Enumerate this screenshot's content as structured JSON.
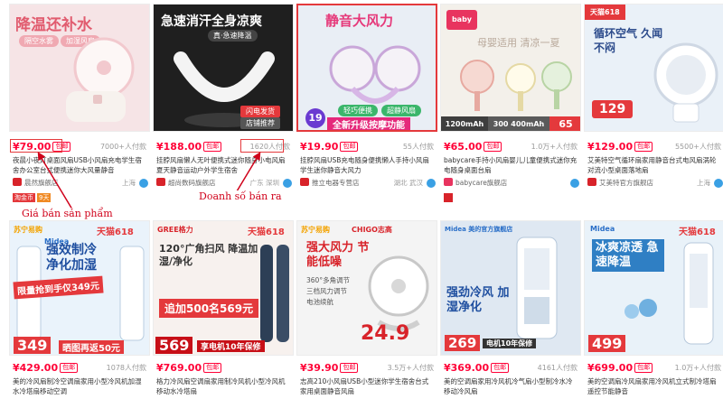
{
  "products": [
    {
      "price": "¥79.00",
      "tag": "包邮",
      "sales": "7000+人付款",
      "title": "夜晨小夜灯桌面风扇USB小风扇充电学生宿舍办公室台式便携迷你大风量静音",
      "shop": "晨然旗舰店",
      "location": "上海",
      "image_heading": "降温还补水",
      "image_sub": [
        "隔空水雾",
        "加湿风扇"
      ],
      "badges": [
        "淘金币",
        "9天"
      ]
    },
    {
      "price": "¥188.00",
      "tag": "包邮",
      "sales": "1620人付款",
      "title": "挂脖风扇懒人无叶便携式迷你随身小电风扇夏天静音运动户外学生宿舍",
      "shop": "超尚数码旗舰店",
      "location": "广东 深圳",
      "image_heading": "急速消汗全身凉爽",
      "image_sub": [
        "真·急速降温"
      ],
      "image_badges": [
        "闪电发货",
        "店铺推荐"
      ]
    },
    {
      "price": "¥19.90",
      "tag": "包邮",
      "sales": "55人付款",
      "title": "挂脖风扇USB充电随身便携懒人手持小风扇学生迷你静音大风力",
      "shop": "推立电器专营店",
      "location": "湖北 武汉",
      "image_heading": "静音大风力",
      "image_price": "19",
      "image_banner": "全新升级按摩功能",
      "image_badges": [
        "轻巧便携",
        "超静风扇"
      ]
    },
    {
      "price": "¥65.00",
      "tag": "包邮",
      "sales": "1.0万+人付款",
      "title": "babycare手持小风扇婴儿儿童便携式迷你充电随身桌面台扇",
      "shop": "babycare旗舰店",
      "location": "",
      "image_heading": "母婴适用 清凉一夏",
      "image_strip": [
        "1200mAh",
        "300 400mAh",
        "65"
      ]
    },
    {
      "price": "¥129.00",
      "tag": "包邮",
      "sales": "5500+人付款",
      "title": "艾美特空气循环扇家用静音台式电风扇涡轮对流小型桌面落地扇",
      "shop": "艾美特官方旗舰店",
      "location": "上海",
      "image_heading": "循环空气 久闻不闷",
      "image_price": "129",
      "image_logo": "天猫618"
    },
    {
      "price": "¥429.00",
      "tag": "包邮",
      "sales": "1078人付款",
      "title": "美的冷风扇制冷空调扇家用小型冷风机加湿水冷塔扇移动空调",
      "shop": "苏宁易购官方旗舰店",
      "location": "",
      "image_heading": "强效制冷 净化加湿",
      "image_promo": "限量抢到手仅349元",
      "image_price": "349",
      "image_banner": "晒图再返50元",
      "image_logos": [
        "苏宁易购",
        "天猫618",
        "Midea"
      ]
    },
    {
      "price": "¥769.00",
      "tag": "包邮",
      "sales": "",
      "title": "格力冷风扇空调扇家用制冷风机小型冷风机移动水冷塔扇",
      "shop": "格力官方旗舰店",
      "location": "",
      "image_heading": "120°广角扫风 降温加湿/净化",
      "image_promo": "追加500名569元",
      "image_price": "569",
      "image_banner": "享电机10年保修",
      "image_logos": [
        "GREE格力",
        "天猫618"
      ]
    },
    {
      "price": "¥39.90",
      "tag": "包邮",
      "sales": "3.5万+人付款",
      "title": "志高210小风扇USB小型迷你学生宿舍台式家用桌面静音风扇",
      "shop": "志高苏宁自营旗舰店",
      "location": "",
      "image_heading": "强大风力 节能低噪",
      "image_features": [
        "360°多角调节",
        "三档风力调节",
        "电池续航"
      ],
      "image_price": "24.9",
      "image_logos": [
        "苏宁易购",
        "CHIGO志高"
      ]
    },
    {
      "price": "¥369.00",
      "tag": "包邮",
      "sales": "4161人付款",
      "title": "美的空调扇家用冷风机冷气扇小型制冷水冷移动冷风扇",
      "shop": "美的官方旗舰店",
      "location": "",
      "image_heading": "强劲冷风 加湿净化",
      "image_price": "269",
      "image_banner": "电机10年保修",
      "image_logos": [
        "Midea 美的官方旗舰店"
      ]
    },
    {
      "price": "¥699.00",
      "tag": "包邮",
      "sales": "1.0万+人付款",
      "title": "美的空调扇冷风扇家用冷风机立式制冷塔扇遥控节能静音",
      "shop": "美的官方旗舰店",
      "location": "",
      "image_heading": "冰爽凉透 急速降温",
      "image_price": "499",
      "image_logos": [
        "Midea",
        "天猫618"
      ]
    }
  ],
  "annotations": {
    "price_label": "Giá bán sản phẩm",
    "sales_label": "Doanh số bán ra"
  },
  "colors": {
    "price_red": "#ff0036",
    "annotation_red": "#d0021b",
    "tmall_red": "#d8232a"
  }
}
